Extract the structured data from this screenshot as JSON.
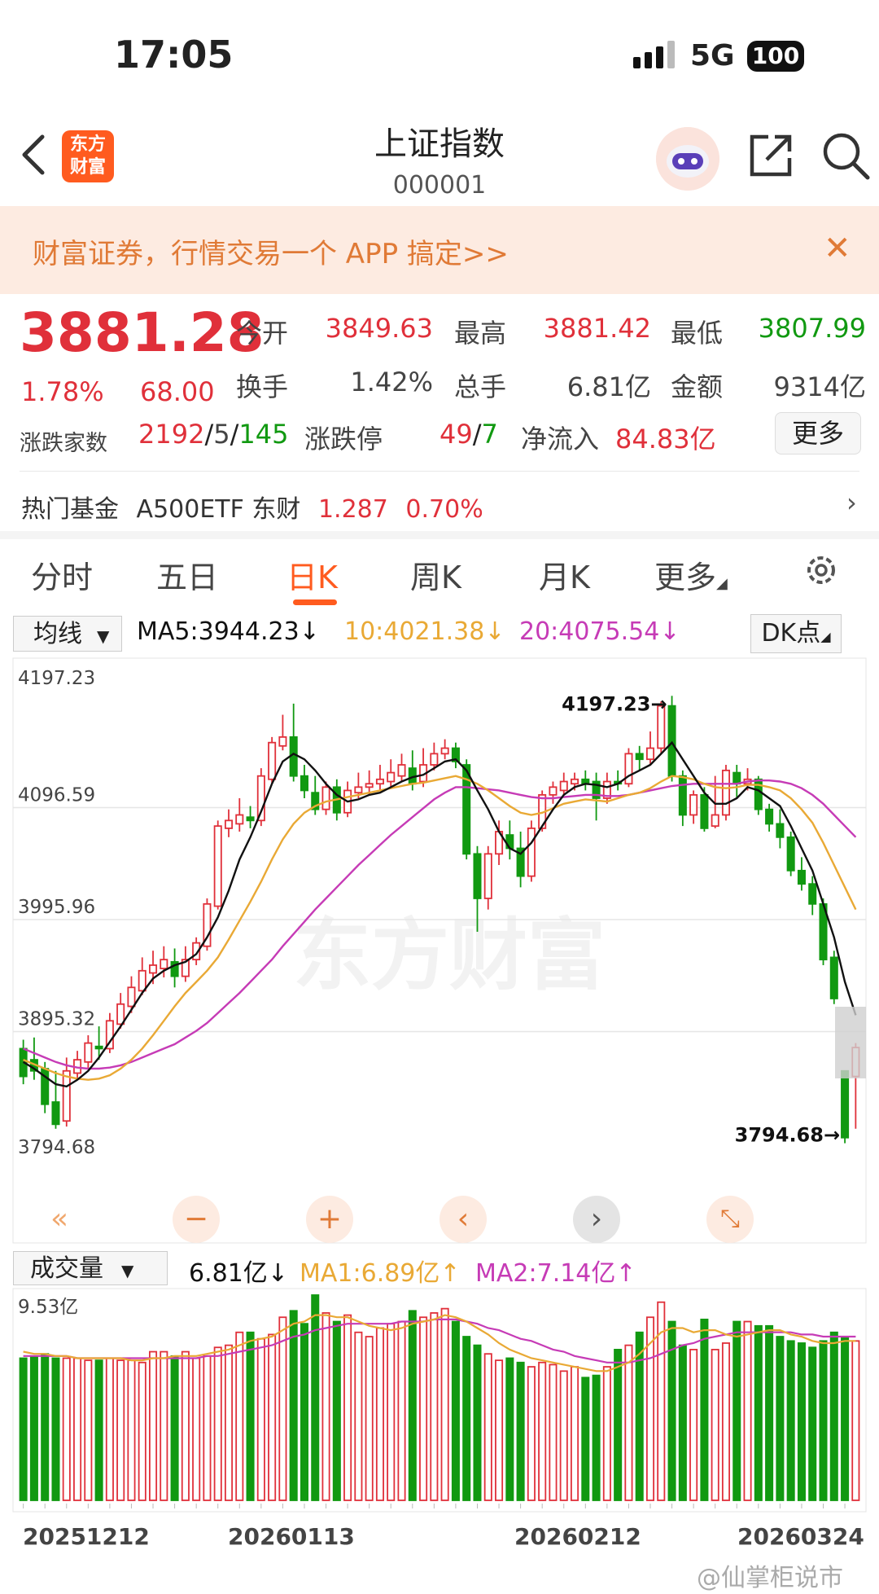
{
  "status": {
    "time": "17:05",
    "network": "5G",
    "battery": "100"
  },
  "header": {
    "title": "上证指数",
    "code": "000001",
    "logo_line1": "东方",
    "logo_line2": "财富"
  },
  "banner": {
    "text": "财富证券，行情交易一个 APP 搞定>>",
    "close": "✕"
  },
  "quote": {
    "price": "3881.28",
    "pct": "1.78%",
    "change": "68.00",
    "row1": [
      {
        "label": "今开",
        "value": "3849.63"
      },
      {
        "label": "最高",
        "value": "3881.42"
      },
      {
        "label": "最低",
        "value": "3807.99"
      }
    ],
    "row2": [
      {
        "label": "换手",
        "value": "1.42%"
      },
      {
        "label": "总手",
        "value": "6.81亿"
      },
      {
        "label": "金额",
        "value": "9314亿"
      }
    ],
    "updown_label": "涨跌家数",
    "up": "2192",
    "flat": "5",
    "down": "145",
    "limit_label": "涨跌停",
    "limit_up": "49",
    "limit_down": "7",
    "inflow_label": "净流入",
    "inflow": "84.83亿",
    "more": "更多"
  },
  "hot_fund": {
    "label": "热门基金",
    "name": "A500ETF 东财",
    "price": "1.287",
    "pct": "0.70%"
  },
  "tabs": [
    "分时",
    "五日",
    "日K",
    "周K",
    "月K",
    "更多"
  ],
  "ma_bar": {
    "select": "均线",
    "ma5": "MA5:3944.23↓",
    "ma10": "10:4021.38↓",
    "ma20": "20:4075.54↓",
    "dk": "DK点"
  },
  "vol_bar": {
    "select": "成交量",
    "current": "6.81亿↓",
    "ma1": "MA1:6.89亿↑",
    "ma2": "MA2:7.14亿↑",
    "max": "9.53亿"
  },
  "dates": [
    "20251212",
    "20260113",
    "20260212",
    "20260324"
  ],
  "watermark": "东方财富",
  "weibo": "@仙掌柜说市",
  "colors": {
    "up": "#e0303a",
    "down": "#119911",
    "ma5": "#111111",
    "ma10": "#e9a935",
    "ma20": "#c63bb6",
    "accent": "#ff5b1f"
  },
  "chart_data": {
    "type": "candlestick",
    "y_ticks": [
      "4197.23",
      "4096.59",
      "3995.96",
      "3895.32",
      "3794.68"
    ],
    "ylim": [
      3794.68,
      4197.23
    ],
    "high_label": "4197.23→",
    "low_label": "3794.68→",
    "candles": [
      [
        3880,
        3855,
        3888,
        3848
      ],
      [
        3870,
        3860,
        3890,
        3852
      ],
      [
        3862,
        3830,
        3868,
        3822
      ],
      [
        3832,
        3812,
        3860,
        3808
      ],
      [
        3815,
        3860,
        3872,
        3810
      ],
      [
        3858,
        3870,
        3878,
        3852
      ],
      [
        3868,
        3885,
        3892,
        3862
      ],
      [
        3882,
        3880,
        3900,
        3870
      ],
      [
        3880,
        3905,
        3912,
        3876
      ],
      [
        3902,
        3920,
        3930,
        3898
      ],
      [
        3918,
        3935,
        3945,
        3912
      ],
      [
        3932,
        3950,
        3962,
        3928
      ],
      [
        3948,
        3955,
        3968,
        3938
      ],
      [
        3952,
        3960,
        3972,
        3944
      ],
      [
        3958,
        3945,
        3970,
        3935
      ],
      [
        3945,
        3960,
        3972,
        3940
      ],
      [
        3960,
        3975,
        3980,
        3955
      ],
      [
        3972,
        4010,
        4015,
        3968
      ],
      [
        4008,
        4080,
        4085,
        4005
      ],
      [
        4078,
        4085,
        4095,
        4070
      ],
      [
        4082,
        4090,
        4105,
        4075
      ],
      [
        4088,
        4085,
        4098,
        4078
      ],
      [
        4085,
        4125,
        4132,
        4080
      ],
      [
        4122,
        4155,
        4160,
        4118
      ],
      [
        4152,
        4160,
        4180,
        4148
      ],
      [
        4160,
        4125,
        4190,
        4120
      ],
      [
        4125,
        4112,
        4135,
        4105
      ],
      [
        4110,
        4095,
        4125,
        4090
      ],
      [
        4095,
        4115,
        4120,
        4090
      ],
      [
        4115,
        4092,
        4122,
        4085
      ],
      [
        4092,
        4112,
        4120,
        4088
      ],
      [
        4110,
        4115,
        4128,
        4105
      ],
      [
        4115,
        4118,
        4130,
        4108
      ],
      [
        4118,
        4122,
        4135,
        4112
      ],
      [
        4120,
        4128,
        4140,
        4115
      ],
      [
        4125,
        4135,
        4145,
        4120
      ],
      [
        4132,
        4118,
        4148,
        4112
      ],
      [
        4120,
        4135,
        4150,
        4115
      ],
      [
        4135,
        4145,
        4155,
        4130
      ],
      [
        4145,
        4150,
        4158,
        4140
      ],
      [
        4150,
        4138,
        4155,
        4132
      ],
      [
        4135,
        4055,
        4140,
        4050
      ],
      [
        4055,
        4015,
        4062,
        3985
      ],
      [
        4015,
        4055,
        4062,
        4005
      ],
      [
        4055,
        4075,
        4085,
        4045
      ],
      [
        4072,
        4060,
        4085,
        4050
      ],
      [
        4060,
        4035,
        4075,
        4025
      ],
      [
        4035,
        4078,
        4085,
        4030
      ],
      [
        4078,
        4108,
        4112,
        4075
      ],
      [
        4108,
        4115,
        4120,
        4100
      ],
      [
        4112,
        4120,
        4128,
        4108
      ],
      [
        4118,
        4122,
        4128,
        4112
      ],
      [
        4122,
        4118,
        4130,
        4112
      ],
      [
        4120,
        4105,
        4128,
        4085
      ],
      [
        4105,
        4120,
        4128,
        4100
      ],
      [
        4120,
        4118,
        4130,
        4112
      ],
      [
        4118,
        4145,
        4150,
        4115
      ],
      [
        4145,
        4140,
        4152,
        4130
      ],
      [
        4140,
        4150,
        4165,
        4135
      ],
      [
        4150,
        4188,
        4192,
        4145
      ],
      [
        4188,
        4125,
        4197,
        4120
      ],
      [
        4125,
        4090,
        4130,
        4080
      ],
      [
        4090,
        4108,
        4112,
        4082
      ],
      [
        4108,
        4078,
        4115,
        4075
      ],
      [
        4080,
        4090,
        4125,
        4078
      ],
      [
        4090,
        4130,
        4135,
        4085
      ],
      [
        4128,
        4118,
        4135,
        4105
      ],
      [
        4118,
        4122,
        4132,
        4112
      ],
      [
        4122,
        4095,
        4125,
        4090
      ],
      [
        4095,
        4082,
        4100,
        4075
      ],
      [
        4082,
        4070,
        4095,
        4060
      ],
      [
        4070,
        4040,
        4075,
        4035
      ],
      [
        4040,
        4028,
        4052,
        4022
      ],
      [
        4028,
        4010,
        4035,
        4000
      ],
      [
        4010,
        3960,
        4015,
        3955
      ],
      [
        3962,
        3925,
        3968,
        3920
      ],
      [
        3860,
        3800,
        3860,
        3795
      ],
      [
        3855,
        3881,
        3885,
        3808
      ]
    ],
    "ma5": [
      3868,
      3862,
      3855,
      3848,
      3846,
      3852,
      3860,
      3872,
      3886,
      3900,
      3915,
      3930,
      3943,
      3950,
      3955,
      3958,
      3965,
      3980,
      3998,
      4022,
      4050,
      4070,
      4093,
      4118,
      4138,
      4145,
      4140,
      4130,
      4118,
      4108,
      4102,
      4104,
      4108,
      4110,
      4115,
      4120,
      4124,
      4126,
      4132,
      4138,
      4140,
      4130,
      4112,
      4095,
      4075,
      4060,
      4055,
      4065,
      4080,
      4095,
      4108,
      4115,
      4118,
      4117,
      4115,
      4118,
      4125,
      4130,
      4135,
      4145,
      4155,
      4140,
      4125,
      4110,
      4100,
      4100,
      4105,
      4115,
      4112,
      4105,
      4098,
      4080,
      4060,
      4040,
      4010,
      3980,
      3940,
      3910
    ],
    "ma10": [
      3870,
      3866,
      3862,
      3858,
      3855,
      3853,
      3852,
      3853,
      3856,
      3862,
      3870,
      3880,
      3892,
      3905,
      3918,
      3930,
      3940,
      3950,
      3962,
      3978,
      3995,
      4012,
      4030,
      4050,
      4068,
      4082,
      4092,
      4098,
      4102,
      4104,
      4106,
      4108,
      4110,
      4112,
      4114,
      4116,
      4118,
      4119,
      4121,
      4123,
      4125,
      4122,
      4118,
      4112,
      4105,
      4098,
      4092,
      4090,
      4092,
      4096,
      4100,
      4102,
      4104,
      4103,
      4102,
      4105,
      4108,
      4110,
      4114,
      4120,
      4125,
      4124,
      4122,
      4118,
      4115,
      4114,
      4115,
      4117,
      4117,
      4115,
      4112,
      4105,
      4095,
      4083,
      4065,
      4045,
      4025,
      4005
    ],
    "ma20": [
      3880,
      3876,
      3872,
      3868,
      3865,
      3863,
      3862,
      3862,
      3863,
      3865,
      3868,
      3872,
      3876,
      3880,
      3884,
      3890,
      3896,
      3903,
      3912,
      3921,
      3930,
      3940,
      3950,
      3960,
      3972,
      3983,
      3994,
      4005,
      4015,
      4025,
      4035,
      4045,
      4054,
      4063,
      4072,
      4080,
      4088,
      4096,
      4104,
      4110,
      4115,
      4115,
      4114,
      4113,
      4112,
      4110,
      4108,
      4106,
      4105,
      4105,
      4106,
      4107,
      4108,
      4108,
      4107,
      4107,
      4108,
      4110,
      4112,
      4114,
      4116,
      4117,
      4118,
      4118,
      4118,
      4118,
      4118,
      4120,
      4121,
      4121,
      4120,
      4118,
      4114,
      4108,
      4100,
      4090,
      4080,
      4070
    ],
    "volume": [
      6.6,
      6.7,
      6.8,
      6.6,
      6.6,
      6.6,
      6.5,
      6.5,
      6.6,
      6.5,
      6.5,
      6.4,
      6.9,
      6.9,
      6.7,
      6.9,
      6.6,
      6.7,
      7.1,
      7.2,
      7.8,
      7.8,
      7.5,
      7.7,
      8.5,
      8.8,
      8.2,
      9.53,
      8.7,
      8.3,
      8.6,
      7.8,
      7.6,
      8.0,
      8.2,
      8.3,
      8.8,
      8.5,
      8.7,
      8.9,
      8.3,
      7.6,
      7.2,
      6.8,
      6.5,
      6.6,
      6.4,
      6.2,
      6.4,
      6.3,
      6.0,
      6.2,
      5.7,
      5.8,
      6.2,
      7.0,
      7.2,
      7.8,
      8.5,
      9.2,
      8.3,
      7.2,
      7.0,
      8.4,
      7.0,
      7.3,
      8.3,
      8.3,
      8.1,
      8.1,
      7.6,
      7.4,
      7.3,
      7.1,
      7.4,
      7.8,
      7.6,
      7.4
    ],
    "vol_ma1": [
      6.9,
      6.8,
      6.8,
      6.7,
      6.7,
      6.6,
      6.6,
      6.6,
      6.6,
      6.6,
      6.5,
      6.5,
      6.6,
      6.6,
      6.7,
      6.7,
      6.7,
      6.8,
      6.9,
      7.0,
      7.2,
      7.4,
      7.5,
      7.6,
      7.9,
      8.2,
      8.3,
      8.6,
      8.6,
      8.5,
      8.5,
      8.3,
      8.1,
      8.0,
      7.9,
      8.0,
      8.2,
      8.3,
      8.4,
      8.6,
      8.5,
      8.3,
      8.0,
      7.7,
      7.3,
      7.0,
      6.8,
      6.6,
      6.5,
      6.4,
      6.3,
      6.2,
      6.1,
      6.0,
      6.0,
      6.2,
      6.4,
      6.8,
      7.3,
      7.8,
      8.0,
      8.0,
      7.8,
      7.9,
      7.9,
      7.7,
      7.6,
      7.7,
      7.8,
      7.9,
      7.9,
      7.7,
      7.6,
      7.4,
      7.3,
      7.3,
      7.4,
      7.4
    ],
    "vol_ma2": [
      6.7,
      6.7,
      6.7,
      6.7,
      6.7,
      6.6,
      6.6,
      6.6,
      6.6,
      6.6,
      6.6,
      6.6,
      6.6,
      6.6,
      6.6,
      6.6,
      6.6,
      6.7,
      6.7,
      6.8,
      6.9,
      7.0,
      7.1,
      7.2,
      7.4,
      7.6,
      7.7,
      7.9,
      8.0,
      8.1,
      8.2,
      8.2,
      8.2,
      8.2,
      8.2,
      8.3,
      8.3,
      8.3,
      8.4,
      8.4,
      8.4,
      8.3,
      8.2,
      8.0,
      7.9,
      7.7,
      7.5,
      7.4,
      7.2,
      7.0,
      6.9,
      6.7,
      6.6,
      6.5,
      6.4,
      6.4,
      6.4,
      6.5,
      6.6,
      6.8,
      7.0,
      7.2,
      7.3,
      7.5,
      7.6,
      7.7,
      7.8,
      7.8,
      7.8,
      7.8,
      7.8,
      7.8,
      7.7,
      7.7,
      7.6,
      7.6,
      7.6,
      7.6
    ],
    "vol_max": 9.53
  }
}
